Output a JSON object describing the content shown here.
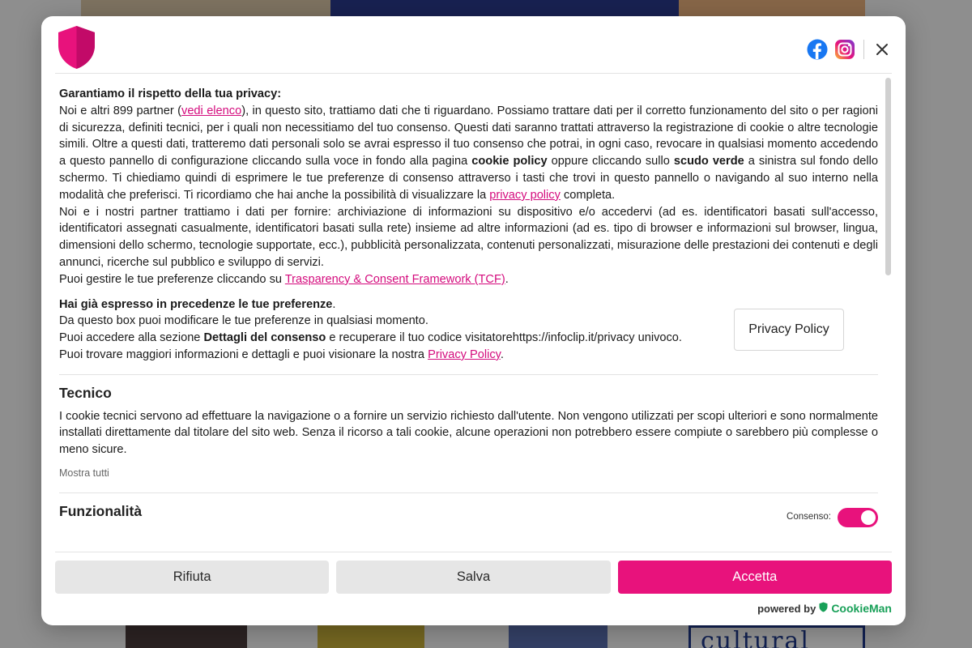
{
  "background": {
    "bottom_brand_text": "cultural"
  },
  "colors": {
    "accent": "#e8127c",
    "link": "#d40b7d",
    "brand_green": "#18a058"
  },
  "header": {
    "icons": [
      "shield-logo-icon",
      "facebook-icon",
      "instagram-icon",
      "close-icon"
    ],
    "close_glyph": "✕"
  },
  "intro": {
    "heading": "Garantiamo il rispetto della tua privacy:",
    "p1_a": "Noi e altri 899 partner (",
    "p1_link": "vedi elenco",
    "p1_b": "), in questo sito, trattiamo dati che ti riguardano. Possiamo trattare dati per il corretto funzionamento del sito o per ragioni di sicurezza, definiti tecnici, per i quali non necessitiamo del tuo consenso. Questi dati saranno trattati attraverso la registrazione di cookie o altre tecnologie simili. Oltre a questi dati, tratteremo dati personali solo se avrai espresso il tuo consenso che potrai, in ogni caso, revocare in qualsiasi momento accedendo a questo pannello di configurazione cliccando sulla voce in fondo alla pagina ",
    "p1_bold1": "cookie policy",
    "p1_c": " oppure cliccando sullo ",
    "p1_bold2": "scudo verde",
    "p1_d": " a sinistra sul fondo dello schermo. Ti chiediamo quindi di esprimere le tue preferenze di consenso attraverso i tasti che trovi in questo pannello o navigando al suo interno nella modalità che preferisci. Ti ricordiamo che hai anche la possibilità di visualizzare la ",
    "p1_link2": "privacy policy",
    "p1_e": " completa.",
    "p2": "Noi e i nostri partner trattiamo i dati per fornire: archiviazione di informazioni su dispositivo e/o accedervi (ad es. identificatori basati sull'accesso, identificatori assegnati casualmente, identificatori basati sulla rete) insieme ad altre informazioni (ad es. tipo di browser e informazioni sul browser, lingua, dimensioni dello schermo, tecnologie supportate, ecc.), pubblicità personalizzata, contenuti personalizzati, misurazione delle prestazioni dei contenuti e degli annunci, ricerche sul pubblico e sviluppo di servizi.",
    "p3_a": "Puoi gestire le tue preferenze cliccando su ",
    "p3_link": "Trasparency & Consent Framework (TCF)",
    "p3_b": "."
  },
  "preferences": {
    "heading": "Hai già espresso in precedenze le tue preferenze",
    "heading_dot": ".",
    "line1": "Da questo box puoi modificare le tue preferenze in qualsiasi momento.",
    "line2_a": "Puoi accedere alla sezione ",
    "line2_bold": "Dettagli del consenso",
    "line2_b": " e recuperare il tuo codice visitatorehttps://infoclip.it/privacy univoco.",
    "line3_a": "Puoi trovare maggiori informazioni e dettagli e puoi visionare la nostra ",
    "line3_link": "Privacy Policy",
    "line3_b": ".",
    "button_label": "Privacy Policy"
  },
  "sections": {
    "tecnico": {
      "title": "Tecnico",
      "description": "I cookie tecnici servono ad effettuare la navigazione o a fornire un servizio richiesto dall'utente. Non vengono utilizzati per scopi ulteriori e sono normalmente installati direttamente dal titolare del sito web. Senza il ricorso a tali cookie, alcune operazioni non potrebbero essere compiute o sarebbero più complesse o meno sicure.",
      "show_all": "Mostra tutti"
    },
    "funzionalita": {
      "title": "Funzionalità",
      "consent_label": "Consenso:",
      "consent_on": true
    }
  },
  "footer": {
    "reject": "Rifiuta",
    "save": "Salva",
    "accept": "Accetta",
    "powered_by": "powered by",
    "brand": "CookieMan"
  }
}
